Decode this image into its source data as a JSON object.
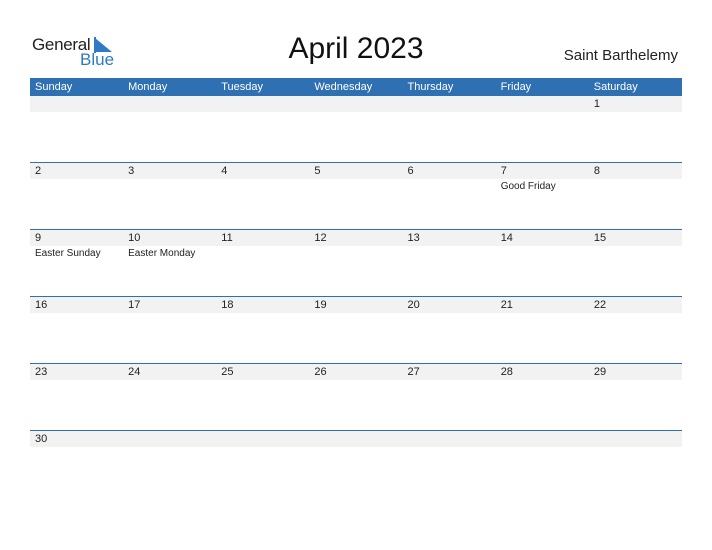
{
  "logo": {
    "general": "General",
    "blue": "Blue"
  },
  "title": "April 2023",
  "country": "Saint Barthelemy",
  "colors": {
    "header": "#2e70b1",
    "accent": "#2e7ac5",
    "strip": "#f2f2f2"
  },
  "weekdays": [
    "Sunday",
    "Monday",
    "Tuesday",
    "Wednesday",
    "Thursday",
    "Friday",
    "Saturday"
  ],
  "weeks": [
    [
      {
        "day": ""
      },
      {
        "day": ""
      },
      {
        "day": ""
      },
      {
        "day": ""
      },
      {
        "day": ""
      },
      {
        "day": ""
      },
      {
        "day": "1"
      }
    ],
    [
      {
        "day": "2"
      },
      {
        "day": "3"
      },
      {
        "day": "4"
      },
      {
        "day": "5"
      },
      {
        "day": "6"
      },
      {
        "day": "7",
        "holiday": "Good Friday"
      },
      {
        "day": "8"
      }
    ],
    [
      {
        "day": "9",
        "holiday": "Easter Sunday"
      },
      {
        "day": "10",
        "holiday": "Easter Monday"
      },
      {
        "day": "11"
      },
      {
        "day": "12"
      },
      {
        "day": "13"
      },
      {
        "day": "14"
      },
      {
        "day": "15"
      }
    ],
    [
      {
        "day": "16"
      },
      {
        "day": "17"
      },
      {
        "day": "18"
      },
      {
        "day": "19"
      },
      {
        "day": "20"
      },
      {
        "day": "21"
      },
      {
        "day": "22"
      }
    ],
    [
      {
        "day": "23"
      },
      {
        "day": "24"
      },
      {
        "day": "25"
      },
      {
        "day": "26"
      },
      {
        "day": "27"
      },
      {
        "day": "28"
      },
      {
        "day": "29"
      }
    ],
    [
      {
        "day": "30"
      },
      {
        "day": ""
      },
      {
        "day": ""
      },
      {
        "day": ""
      },
      {
        "day": ""
      },
      {
        "day": ""
      },
      {
        "day": ""
      }
    ]
  ]
}
